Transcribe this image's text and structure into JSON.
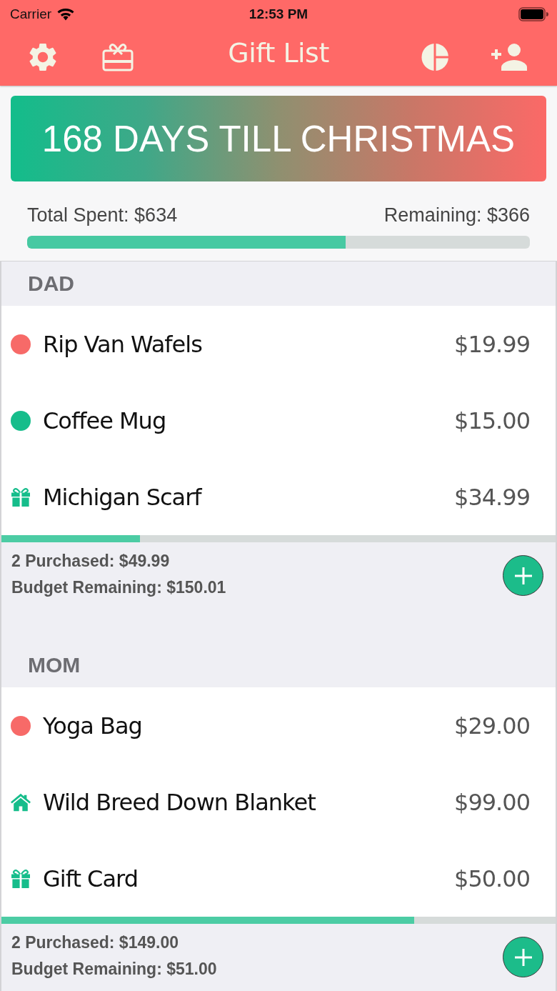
{
  "status_bar": {
    "carrier": "Carrier",
    "time": "12:53 PM"
  },
  "nav_bar": {
    "title": "Gift List"
  },
  "banner": {
    "text": "168 DAYS TILL CHRISTMAS"
  },
  "totals": {
    "spent": "Total Spent: $634",
    "remaining": "Remaining: $366",
    "level": 0.634
  },
  "sections": [
    {
      "title": "DAD",
      "items": [
        {
          "kind": "dot",
          "color": "#f76a68",
          "name": "Rip Van Wafels",
          "price": "$19.99"
        },
        {
          "kind": "dot",
          "color": "#16bd8b",
          "name": "Coffee Mug",
          "price": "$15.00"
        },
        {
          "kind": "gift",
          "name": "Michigan Scarf",
          "price": "$34.99"
        }
      ],
      "level": 0.25,
      "purchased": "2 Purchased: $49.99",
      "budget_remaining": "Budget Remaining: $150.01"
    },
    {
      "title": "MOM",
      "items": [
        {
          "kind": "dot",
          "color": "#f76a68",
          "name": "Yoga Bag",
          "price": "$29.00"
        },
        {
          "kind": "house",
          "name": "Wild Breed Down Blanket",
          "price": "$99.00"
        },
        {
          "kind": "gift",
          "name": "Gift Card",
          "price": "$50.00"
        }
      ],
      "level": 0.745,
      "purchased": "2 Purchased: $149.00",
      "budget_remaining": "Budget Remaining: $51.00"
    }
  ]
}
